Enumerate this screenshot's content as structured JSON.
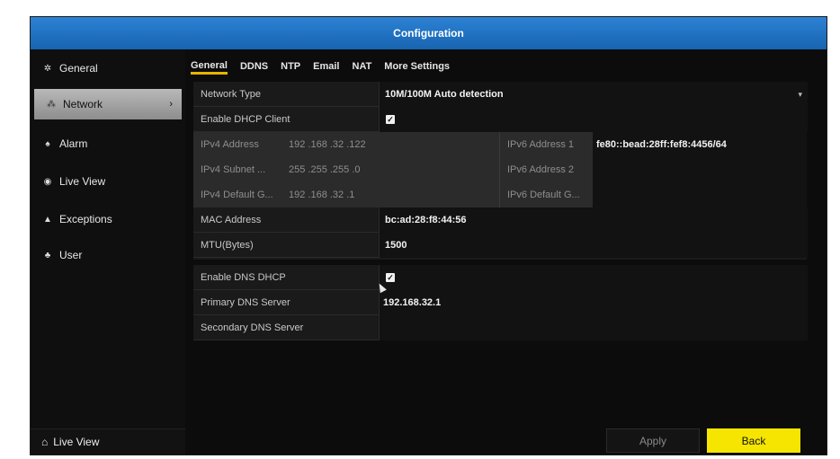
{
  "window": {
    "title": "Configuration"
  },
  "sidebar": {
    "items": [
      {
        "label": "General",
        "icon": "gear-icon"
      },
      {
        "label": "Network",
        "icon": "network-icon",
        "active": true
      },
      {
        "label": "Alarm",
        "icon": "bell-icon"
      },
      {
        "label": "Live View",
        "icon": "eye-icon"
      },
      {
        "label": "Exceptions",
        "icon": "warning-icon"
      },
      {
        "label": "User",
        "icon": "users-icon"
      }
    ],
    "bottom": {
      "label": "Live View",
      "icon": "home-icon"
    }
  },
  "tabs": [
    "General",
    "DDNS",
    "NTP",
    "Email",
    "NAT",
    "More Settings"
  ],
  "active_tab": "General",
  "form": {
    "network_type": {
      "label": "Network Type",
      "value": "10M/100M Auto detection"
    },
    "enable_dhcp": {
      "label": "Enable DHCP Client",
      "checked": true
    },
    "ipv4_address": {
      "label": "IPv4 Address",
      "value": "192 .168 .32  .122"
    },
    "ipv4_subnet": {
      "label": "IPv4 Subnet ...",
      "value": "255 .255 .255 .0"
    },
    "ipv4_gateway": {
      "label": "IPv4 Default G...",
      "value": "192 .168 .32  .1"
    },
    "ipv6_address1": {
      "label": "IPv6 Address 1",
      "value": "fe80::bead:28ff:fef8:4456/64"
    },
    "ipv6_address2": {
      "label": "IPv6 Address 2",
      "value": ""
    },
    "ipv6_gateway": {
      "label": "IPv6 Default G...",
      "value": ""
    },
    "mac_address": {
      "label": "MAC Address",
      "value": "bc:ad:28:f8:44:56"
    },
    "mtu": {
      "label": "MTU(Bytes)",
      "value": "1500"
    },
    "enable_dns_dhcp": {
      "label": "Enable DNS DHCP",
      "checked": true
    },
    "primary_dns": {
      "label": "Primary DNS Server",
      "value": "192.168.32.1"
    },
    "secondary_dns": {
      "label": "Secondary DNS Server",
      "value": ""
    }
  },
  "buttons": {
    "apply": "Apply",
    "back": "Back"
  },
  "colors": {
    "titlebar": "#1f6fbf",
    "tab_underline": "#e8b400",
    "back_button": "#f5e500"
  }
}
